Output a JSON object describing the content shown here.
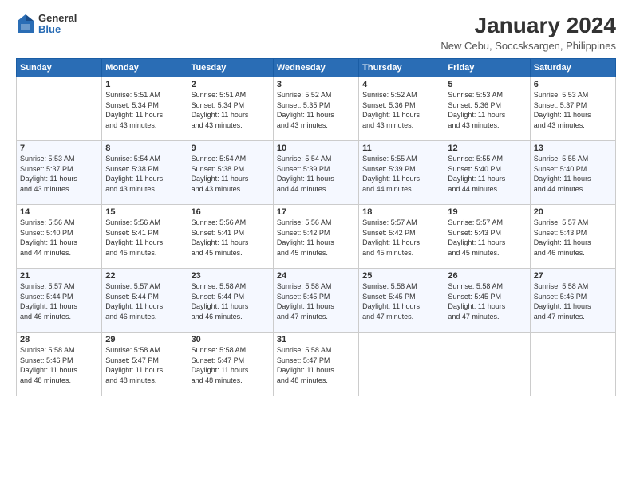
{
  "logo": {
    "general": "General",
    "blue": "Blue"
  },
  "title": "January 2024",
  "subtitle": "New Cebu, Soccsksargen, Philippines",
  "header": {
    "days": [
      "Sunday",
      "Monday",
      "Tuesday",
      "Wednesday",
      "Thursday",
      "Friday",
      "Saturday"
    ]
  },
  "weeks": [
    [
      {
        "day": "",
        "info": ""
      },
      {
        "day": "1",
        "info": "Sunrise: 5:51 AM\nSunset: 5:34 PM\nDaylight: 11 hours\nand 43 minutes."
      },
      {
        "day": "2",
        "info": "Sunrise: 5:51 AM\nSunset: 5:34 PM\nDaylight: 11 hours\nand 43 minutes."
      },
      {
        "day": "3",
        "info": "Sunrise: 5:52 AM\nSunset: 5:35 PM\nDaylight: 11 hours\nand 43 minutes."
      },
      {
        "day": "4",
        "info": "Sunrise: 5:52 AM\nSunset: 5:36 PM\nDaylight: 11 hours\nand 43 minutes."
      },
      {
        "day": "5",
        "info": "Sunrise: 5:53 AM\nSunset: 5:36 PM\nDaylight: 11 hours\nand 43 minutes."
      },
      {
        "day": "6",
        "info": "Sunrise: 5:53 AM\nSunset: 5:37 PM\nDaylight: 11 hours\nand 43 minutes."
      }
    ],
    [
      {
        "day": "7",
        "info": "Sunrise: 5:53 AM\nSunset: 5:37 PM\nDaylight: 11 hours\nand 43 minutes."
      },
      {
        "day": "8",
        "info": "Sunrise: 5:54 AM\nSunset: 5:38 PM\nDaylight: 11 hours\nand 43 minutes."
      },
      {
        "day": "9",
        "info": "Sunrise: 5:54 AM\nSunset: 5:38 PM\nDaylight: 11 hours\nand 43 minutes."
      },
      {
        "day": "10",
        "info": "Sunrise: 5:54 AM\nSunset: 5:39 PM\nDaylight: 11 hours\nand 44 minutes."
      },
      {
        "day": "11",
        "info": "Sunrise: 5:55 AM\nSunset: 5:39 PM\nDaylight: 11 hours\nand 44 minutes."
      },
      {
        "day": "12",
        "info": "Sunrise: 5:55 AM\nSunset: 5:40 PM\nDaylight: 11 hours\nand 44 minutes."
      },
      {
        "day": "13",
        "info": "Sunrise: 5:55 AM\nSunset: 5:40 PM\nDaylight: 11 hours\nand 44 minutes."
      }
    ],
    [
      {
        "day": "14",
        "info": "Sunrise: 5:56 AM\nSunset: 5:40 PM\nDaylight: 11 hours\nand 44 minutes."
      },
      {
        "day": "15",
        "info": "Sunrise: 5:56 AM\nSunset: 5:41 PM\nDaylight: 11 hours\nand 45 minutes."
      },
      {
        "day": "16",
        "info": "Sunrise: 5:56 AM\nSunset: 5:41 PM\nDaylight: 11 hours\nand 45 minutes."
      },
      {
        "day": "17",
        "info": "Sunrise: 5:56 AM\nSunset: 5:42 PM\nDaylight: 11 hours\nand 45 minutes."
      },
      {
        "day": "18",
        "info": "Sunrise: 5:57 AM\nSunset: 5:42 PM\nDaylight: 11 hours\nand 45 minutes."
      },
      {
        "day": "19",
        "info": "Sunrise: 5:57 AM\nSunset: 5:43 PM\nDaylight: 11 hours\nand 45 minutes."
      },
      {
        "day": "20",
        "info": "Sunrise: 5:57 AM\nSunset: 5:43 PM\nDaylight: 11 hours\nand 46 minutes."
      }
    ],
    [
      {
        "day": "21",
        "info": "Sunrise: 5:57 AM\nSunset: 5:44 PM\nDaylight: 11 hours\nand 46 minutes."
      },
      {
        "day": "22",
        "info": "Sunrise: 5:57 AM\nSunset: 5:44 PM\nDaylight: 11 hours\nand 46 minutes."
      },
      {
        "day": "23",
        "info": "Sunrise: 5:58 AM\nSunset: 5:44 PM\nDaylight: 11 hours\nand 46 minutes."
      },
      {
        "day": "24",
        "info": "Sunrise: 5:58 AM\nSunset: 5:45 PM\nDaylight: 11 hours\nand 47 minutes."
      },
      {
        "day": "25",
        "info": "Sunrise: 5:58 AM\nSunset: 5:45 PM\nDaylight: 11 hours\nand 47 minutes."
      },
      {
        "day": "26",
        "info": "Sunrise: 5:58 AM\nSunset: 5:45 PM\nDaylight: 11 hours\nand 47 minutes."
      },
      {
        "day": "27",
        "info": "Sunrise: 5:58 AM\nSunset: 5:46 PM\nDaylight: 11 hours\nand 47 minutes."
      }
    ],
    [
      {
        "day": "28",
        "info": "Sunrise: 5:58 AM\nSunset: 5:46 PM\nDaylight: 11 hours\nand 48 minutes."
      },
      {
        "day": "29",
        "info": "Sunrise: 5:58 AM\nSunset: 5:47 PM\nDaylight: 11 hours\nand 48 minutes."
      },
      {
        "day": "30",
        "info": "Sunrise: 5:58 AM\nSunset: 5:47 PM\nDaylight: 11 hours\nand 48 minutes."
      },
      {
        "day": "31",
        "info": "Sunrise: 5:58 AM\nSunset: 5:47 PM\nDaylight: 11 hours\nand 48 minutes."
      },
      {
        "day": "",
        "info": ""
      },
      {
        "day": "",
        "info": ""
      },
      {
        "day": "",
        "info": ""
      }
    ]
  ]
}
